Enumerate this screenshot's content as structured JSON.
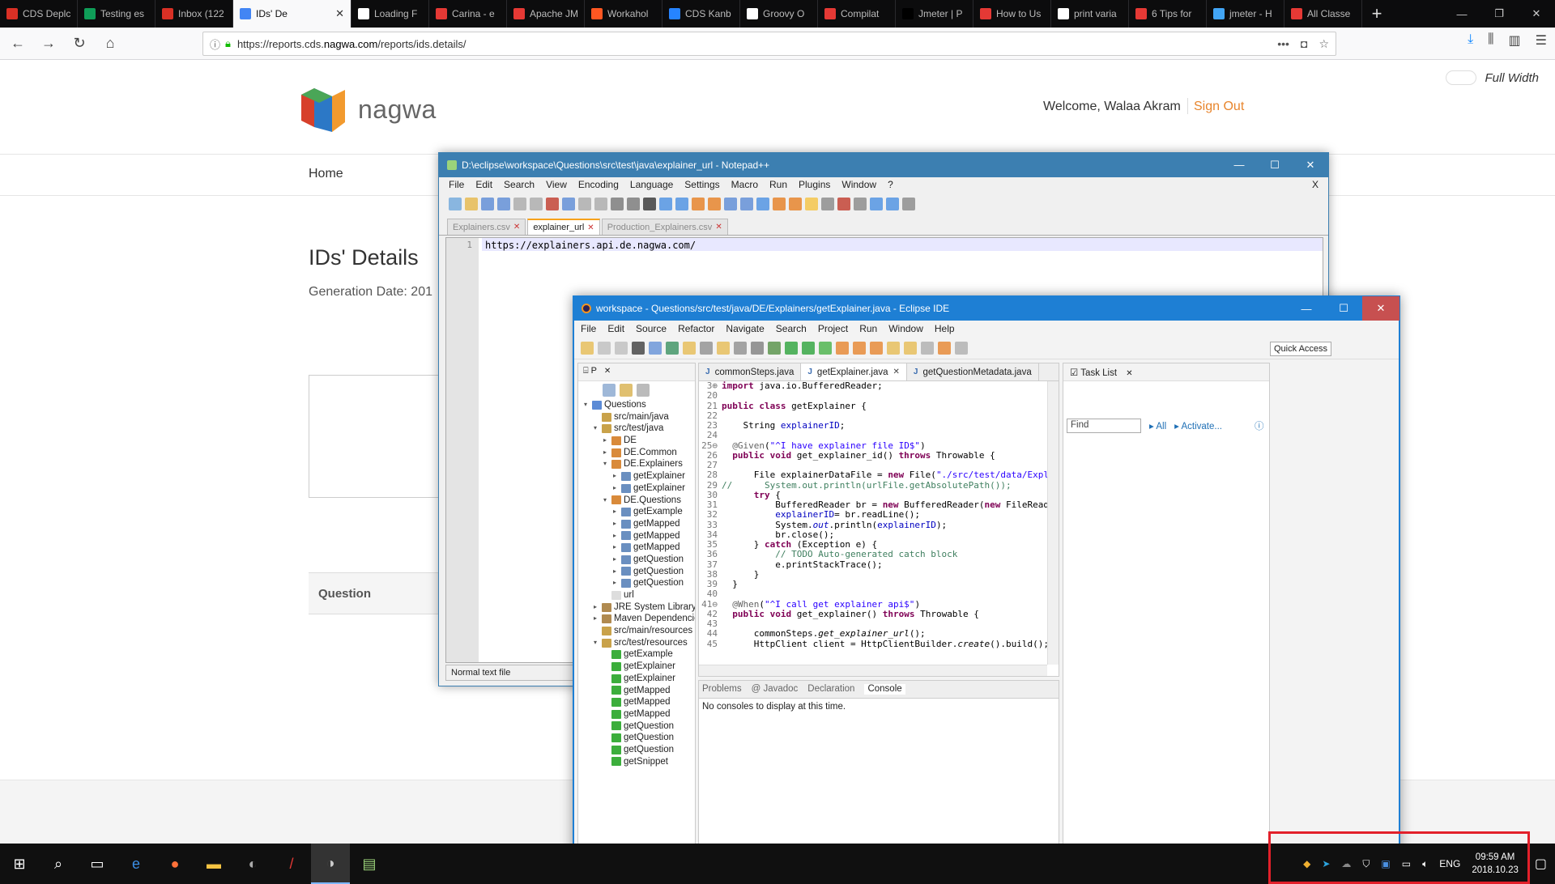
{
  "browser": {
    "tabs": [
      {
        "label": "CDS Deplc",
        "color": "#d93025"
      },
      {
        "label": "Testing es",
        "color": "#0f9d58"
      },
      {
        "label": "Inbox (122",
        "color": "#d93025"
      },
      {
        "label": "IDs' De",
        "color": "#4285f4",
        "active": true
      },
      {
        "label": "Loading F",
        "color": "#ffffff"
      },
      {
        "label": "Carina - e",
        "color": "#e53935"
      },
      {
        "label": "Apache JM",
        "color": "#e53935"
      },
      {
        "label": "Workahol",
        "color": "#ff5722"
      },
      {
        "label": "CDS Kanb",
        "color": "#2684ff"
      },
      {
        "label": "Groovy O",
        "color": "#ffffff"
      },
      {
        "label": "Compilat",
        "color": "#e53935"
      },
      {
        "label": "Jmeter | P",
        "color": "#000000"
      },
      {
        "label": "How to Us",
        "color": "#e53935"
      },
      {
        "label": "print varia",
        "color": "#ffffff"
      },
      {
        "label": "6 Tips for",
        "color": "#e53935"
      },
      {
        "label": "jmeter - H",
        "color": "#42a5f5"
      },
      {
        "label": "All Classe",
        "color": "#e53935"
      }
    ],
    "new_tab": "+",
    "url_prefix": "https://reports.cds.",
    "url_domain": "nagwa.com",
    "url_suffix": "/reports/ids.details/"
  },
  "page": {
    "full_width_label": "Full Width",
    "brand": "nagwa",
    "welcome": "Welcome, Walaa Akram",
    "sign_out": "Sign Out",
    "nav_home": "Home",
    "title": "IDs' Details",
    "generation_date": "Generation Date: 201",
    "question_header": "Question"
  },
  "notepad": {
    "title": "D:\\eclipse\\workspace\\Questions\\src\\test\\java\\explainer_url - Notepad++",
    "menu": [
      "File",
      "Edit",
      "Search",
      "View",
      "Encoding",
      "Language",
      "Settings",
      "Macro",
      "Run",
      "Plugins",
      "Window",
      "?"
    ],
    "menu_close": "X",
    "tabs": [
      {
        "label": "Explainers.csv",
        "active": false
      },
      {
        "label": "explainer_url",
        "active": true
      },
      {
        "label": "Production_Explainers.csv",
        "active": false
      }
    ],
    "line_number": "1",
    "content": "https://explainers.api.de.nagwa.com/",
    "status": "Normal text file"
  },
  "eclipse": {
    "title": "workspace - Questions/src/test/java/DE/Explainers/getExplainer.java - Eclipse IDE",
    "menu": [
      "File",
      "Edit",
      "Source",
      "Refactor",
      "Navigate",
      "Search",
      "Project",
      "Run",
      "Window",
      "Help"
    ],
    "quick_access": "Quick Access",
    "explorer_title": "P",
    "tree": [
      {
        "d": 0,
        "a": "▾",
        "label": "Questions",
        "ic": "#5b8bd6"
      },
      {
        "d": 1,
        "a": "",
        "label": "src/main/java",
        "ic": "#c9a24a"
      },
      {
        "d": 1,
        "a": "▾",
        "label": "src/test/java",
        "ic": "#c9a24a"
      },
      {
        "d": 2,
        "a": "▸",
        "label": "DE",
        "ic": "#d98a3a"
      },
      {
        "d": 2,
        "a": "▸",
        "label": "DE.Common",
        "ic": "#d98a3a"
      },
      {
        "d": 2,
        "a": "▾",
        "label": "DE.Explainers",
        "ic": "#d98a3a"
      },
      {
        "d": 3,
        "a": "▸",
        "label": "getExplainer",
        "ic": "#6a8fc0"
      },
      {
        "d": 3,
        "a": "▸",
        "label": "getExplainer",
        "ic": "#6a8fc0"
      },
      {
        "d": 2,
        "a": "▾",
        "label": "DE.Questions",
        "ic": "#d98a3a"
      },
      {
        "d": 3,
        "a": "▸",
        "label": "getExample",
        "ic": "#6a8fc0"
      },
      {
        "d": 3,
        "a": "▸",
        "label": "getMapped",
        "ic": "#6a8fc0"
      },
      {
        "d": 3,
        "a": "▸",
        "label": "getMapped",
        "ic": "#6a8fc0"
      },
      {
        "d": 3,
        "a": "▸",
        "label": "getMapped",
        "ic": "#6a8fc0"
      },
      {
        "d": 3,
        "a": "▸",
        "label": "getQuestion",
        "ic": "#6a8fc0"
      },
      {
        "d": 3,
        "a": "▸",
        "label": "getQuestion",
        "ic": "#6a8fc0"
      },
      {
        "d": 3,
        "a": "▸",
        "label": "getQuestion",
        "ic": "#6a8fc0"
      },
      {
        "d": 2,
        "a": "",
        "label": "url",
        "ic": "#dddddd"
      },
      {
        "d": 1,
        "a": "▸",
        "label": "JRE System Library",
        "ic": "#b08a50"
      },
      {
        "d": 1,
        "a": "▸",
        "label": "Maven Dependencies",
        "ic": "#b08a50"
      },
      {
        "d": 1,
        "a": "",
        "label": "src/main/resources",
        "ic": "#c9a24a"
      },
      {
        "d": 1,
        "a": "▾",
        "label": "src/test/resources",
        "ic": "#c9a24a"
      },
      {
        "d": 2,
        "a": "",
        "label": "getExample",
        "ic": "#3cae3c"
      },
      {
        "d": 2,
        "a": "",
        "label": "getExplainer",
        "ic": "#3cae3c"
      },
      {
        "d": 2,
        "a": "",
        "label": "getExplainer",
        "ic": "#3cae3c"
      },
      {
        "d": 2,
        "a": "",
        "label": "getMapped",
        "ic": "#3cae3c"
      },
      {
        "d": 2,
        "a": "",
        "label": "getMapped",
        "ic": "#3cae3c"
      },
      {
        "d": 2,
        "a": "",
        "label": "getMapped",
        "ic": "#3cae3c"
      },
      {
        "d": 2,
        "a": "",
        "label": "getQuestion",
        "ic": "#3cae3c"
      },
      {
        "d": 2,
        "a": "",
        "label": "getQuestion",
        "ic": "#3cae3c"
      },
      {
        "d": 2,
        "a": "",
        "label": "getQuestion",
        "ic": "#3cae3c"
      },
      {
        "d": 2,
        "a": "",
        "label": "getSnippet",
        "ic": "#3cae3c"
      }
    ],
    "editor_tabs": [
      {
        "label": "commonSteps.java",
        "active": false
      },
      {
        "label": "getExplainer.java",
        "active": true
      },
      {
        "label": "getQuestionMetadata.java",
        "active": false
      }
    ],
    "code": [
      {
        "n": "3⊕",
        "h": "<span class='kw'>import</span> java.io.BufferedReader;"
      },
      {
        "n": "20",
        "h": ""
      },
      {
        "n": "21",
        "h": "<span class='kw'>public class</span> getExplainer {"
      },
      {
        "n": "22",
        "h": ""
      },
      {
        "n": "23",
        "h": "    String <span class='fld'>explainerID</span>;"
      },
      {
        "n": "24",
        "h": ""
      },
      {
        "n": "25⊖",
        "h": "  <span class='ann'>@Given</span>(<span class='str'>\"^I have explainer file ID$\"</span>)"
      },
      {
        "n": "26",
        "h": "  <span class='kw'>public void</span> get_explainer_id() <span class='kw'>throws</span> Throwable {"
      },
      {
        "n": "27",
        "h": ""
      },
      {
        "n": "28",
        "h": "      File explainerDataFile = <span class='kw'>new</span> File(<span class='str'>\"./src/test/data/Explainers</span>"
      },
      {
        "n": "29",
        "h": "<span class='cmt'>//      System.out.println(urlFile.getAbsolutePath());</span>"
      },
      {
        "n": "30",
        "h": "      <span class='kw'>try</span> {"
      },
      {
        "n": "31",
        "h": "          BufferedReader br = <span class='kw'>new</span> BufferedReader(<span class='kw'>new</span> FileReader(e"
      },
      {
        "n": "32",
        "h": "          <span class='fld'>explainerID</span>= br.readLine();"
      },
      {
        "n": "33",
        "h": "          System.<span class='fld'><i>out</i></span>.println(<span class='fld'>explainerID</span>);"
      },
      {
        "n": "34",
        "h": "          br.close();"
      },
      {
        "n": "35",
        "h": "      } <span class='kw'>catch</span> (Exception e) {"
      },
      {
        "n": "36",
        "h": "          <span class='cmt'>// TODO Auto-generated catch block</span>"
      },
      {
        "n": "37",
        "h": "          e.printStackTrace();"
      },
      {
        "n": "38",
        "h": "      }"
      },
      {
        "n": "39",
        "h": "  }"
      },
      {
        "n": "40",
        "h": ""
      },
      {
        "n": "41⊖",
        "h": "  <span class='ann'>@When</span>(<span class='str'>\"^I call get explainer api$\"</span>)"
      },
      {
        "n": "42",
        "h": "  <span class='kw'>public void</span> get_explainer() <span class='kw'>throws</span> Throwable {"
      },
      {
        "n": "43",
        "h": ""
      },
      {
        "n": "44",
        "h": "      commonSteps.<i>get_explainer_url</i>();"
      },
      {
        "n": "45",
        "h": "      HttpClient client = HttpClientBuilder.<i>create</i>().build();"
      }
    ],
    "console_tabs": [
      {
        "label": "Problems",
        "active": false
      },
      {
        "label": "@ Javadoc",
        "active": false
      },
      {
        "label": "Declaration",
        "active": false
      },
      {
        "label": "Console",
        "active": true
      }
    ],
    "console_message": "No consoles to display at this time.",
    "task_list_title": "Task List",
    "find_placeholder": "Find",
    "filter_all": "All",
    "activate": "Activate..."
  },
  "taskbar": {
    "language": "ENG",
    "time": "09:59 AM",
    "date": "2018.10.23"
  }
}
